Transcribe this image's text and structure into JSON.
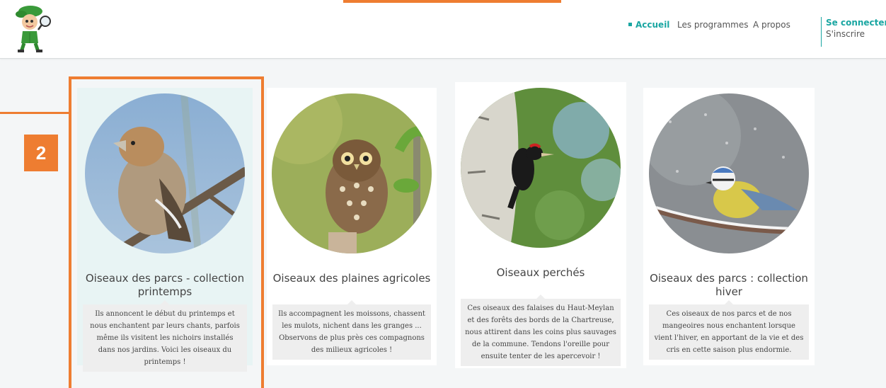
{
  "header": {
    "nav": [
      {
        "label": "Accueil",
        "active": true
      },
      {
        "label": "Les programmes",
        "active": false
      },
      {
        "label": "A propos",
        "active": false
      }
    ],
    "auth": {
      "login": "Se connecter",
      "signup": "S'inscrire"
    }
  },
  "callout": {
    "number": "2"
  },
  "cards": [
    {
      "title": "Oiseaux des parcs - collection printemps",
      "description": "Ils annoncent le début du printemps et nous enchantent par leurs chants, parfois même ils visitent les nichoirs installés dans nos jardins. Voici les oiseaux du printemps !",
      "selected": true
    },
    {
      "title": "Oiseaux des plaines agricoles",
      "description": "Ils accompagnent les moissons, chassent les mulots, nichent dans les granges ... Observons de plus près ces compagnons des milieux agricoles !",
      "selected": false
    },
    {
      "title": "Oiseaux perchés",
      "description": "Ces oiseaux des falaises du Haut-Meylan et des forêts des bords de la Chartreuse, nous attirent dans les coins plus sauvages de la commune. Tendons l'oreille pour ensuite tenter de les apercevoir !",
      "selected": false
    },
    {
      "title": "Oiseaux des parcs : collection hiver",
      "description": "Ces oiseaux de nos parcs et de nos mangeoires nous enchantent lorsque vient l'hiver, en apportant de la vie et des cris en cette saison plus endormie.",
      "selected": false
    }
  ],
  "colors": {
    "accent": "#1aa6a2",
    "highlight": "#ee7d31"
  }
}
